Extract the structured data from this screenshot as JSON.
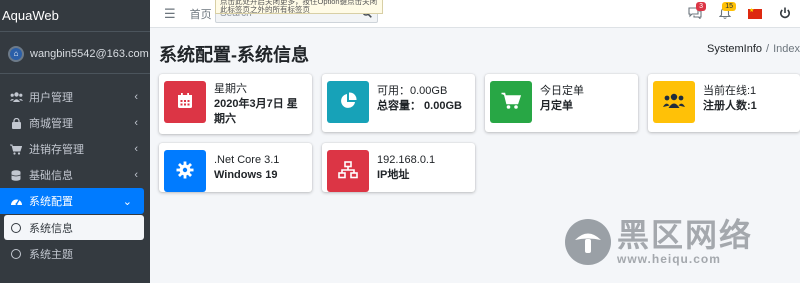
{
  "app": {
    "brand": "AquaWeb"
  },
  "user": {
    "name": "wangbin5542@163.com"
  },
  "sidebar": {
    "items": [
      {
        "label": "用户管理",
        "icon": "users-icon"
      },
      {
        "label": "商城管理",
        "icon": "shop-icon"
      },
      {
        "label": "进销存管理",
        "icon": "cart-icon"
      },
      {
        "label": "基础信息",
        "icon": "database-icon"
      },
      {
        "label": "系统配置",
        "icon": "dashboard-icon",
        "active": true
      }
    ],
    "subitems": [
      {
        "label": "系统信息",
        "selected": true
      },
      {
        "label": "系统主题",
        "selected": false
      }
    ]
  },
  "topbar": {
    "home": "首页",
    "search_placeholder": "Search",
    "tooltip": "点击此处开启关闭更多，按住Option键点击关闭此标签页之外的所有标签页",
    "notifications": {
      "chat_count": "3",
      "bell_count": "15"
    }
  },
  "page": {
    "title": "系统配置-系统信息",
    "breadcrumb": [
      "SystemInfo",
      "Index"
    ]
  },
  "boxes": [
    {
      "line1": "星期六",
      "line2": "2020年3月7日 星期六",
      "color": "#dc3545",
      "icon": "calendar-icon"
    },
    {
      "line1": "可用：0.00GB",
      "line2": "总容量： 0.00GB",
      "color": "#17a2b8",
      "icon": "pie-chart-icon"
    },
    {
      "line1": "今日定单",
      "line2": "月定单",
      "color": "#28a745",
      "icon": "shopping-cart-icon"
    },
    {
      "line1": "当前在线:1",
      "line2": "注册人数:1",
      "color": "#ffc107",
      "icon": "users-icon"
    },
    {
      "line1": ".Net Core 3.1",
      "line2": "Windows 19",
      "color": "#007bff",
      "icon": "gear-icon"
    },
    {
      "line1": "192.168.0.1",
      "line2": "IP地址",
      "color": "#dc3545",
      "icon": "network-icon"
    }
  ],
  "watermark": {
    "cn": "黑区网络",
    "url": "www.heiqu.com"
  }
}
